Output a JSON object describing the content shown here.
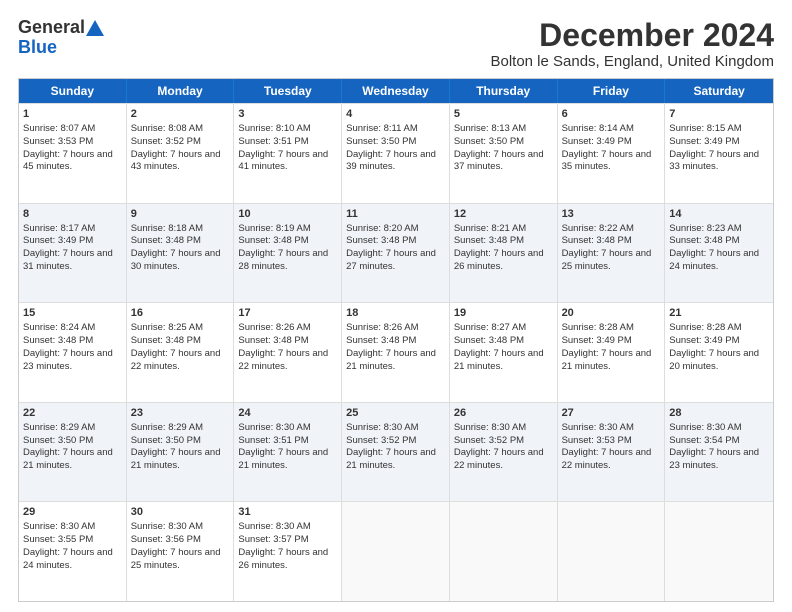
{
  "logo": {
    "line1": "General",
    "line2": "Blue"
  },
  "title": "December 2024",
  "subtitle": "Bolton le Sands, England, United Kingdom",
  "header_days": [
    "Sunday",
    "Monday",
    "Tuesday",
    "Wednesday",
    "Thursday",
    "Friday",
    "Saturday"
  ],
  "weeks": [
    [
      {
        "day": "1",
        "rise": "Sunrise: 8:07 AM",
        "set": "Sunset: 3:53 PM",
        "daylight": "Daylight: 7 hours and 45 minutes."
      },
      {
        "day": "2",
        "rise": "Sunrise: 8:08 AM",
        "set": "Sunset: 3:52 PM",
        "daylight": "Daylight: 7 hours and 43 minutes."
      },
      {
        "day": "3",
        "rise": "Sunrise: 8:10 AM",
        "set": "Sunset: 3:51 PM",
        "daylight": "Daylight: 7 hours and 41 minutes."
      },
      {
        "day": "4",
        "rise": "Sunrise: 8:11 AM",
        "set": "Sunset: 3:50 PM",
        "daylight": "Daylight: 7 hours and 39 minutes."
      },
      {
        "day": "5",
        "rise": "Sunrise: 8:13 AM",
        "set": "Sunset: 3:50 PM",
        "daylight": "Daylight: 7 hours and 37 minutes."
      },
      {
        "day": "6",
        "rise": "Sunrise: 8:14 AM",
        "set": "Sunset: 3:49 PM",
        "daylight": "Daylight: 7 hours and 35 minutes."
      },
      {
        "day": "7",
        "rise": "Sunrise: 8:15 AM",
        "set": "Sunset: 3:49 PM",
        "daylight": "Daylight: 7 hours and 33 minutes."
      }
    ],
    [
      {
        "day": "8",
        "rise": "Sunrise: 8:17 AM",
        "set": "Sunset: 3:49 PM",
        "daylight": "Daylight: 7 hours and 31 minutes."
      },
      {
        "day": "9",
        "rise": "Sunrise: 8:18 AM",
        "set": "Sunset: 3:48 PM",
        "daylight": "Daylight: 7 hours and 30 minutes."
      },
      {
        "day": "10",
        "rise": "Sunrise: 8:19 AM",
        "set": "Sunset: 3:48 PM",
        "daylight": "Daylight: 7 hours and 28 minutes."
      },
      {
        "day": "11",
        "rise": "Sunrise: 8:20 AM",
        "set": "Sunset: 3:48 PM",
        "daylight": "Daylight: 7 hours and 27 minutes."
      },
      {
        "day": "12",
        "rise": "Sunrise: 8:21 AM",
        "set": "Sunset: 3:48 PM",
        "daylight": "Daylight: 7 hours and 26 minutes."
      },
      {
        "day": "13",
        "rise": "Sunrise: 8:22 AM",
        "set": "Sunset: 3:48 PM",
        "daylight": "Daylight: 7 hours and 25 minutes."
      },
      {
        "day": "14",
        "rise": "Sunrise: 8:23 AM",
        "set": "Sunset: 3:48 PM",
        "daylight": "Daylight: 7 hours and 24 minutes."
      }
    ],
    [
      {
        "day": "15",
        "rise": "Sunrise: 8:24 AM",
        "set": "Sunset: 3:48 PM",
        "daylight": "Daylight: 7 hours and 23 minutes."
      },
      {
        "day": "16",
        "rise": "Sunrise: 8:25 AM",
        "set": "Sunset: 3:48 PM",
        "daylight": "Daylight: 7 hours and 22 minutes."
      },
      {
        "day": "17",
        "rise": "Sunrise: 8:26 AM",
        "set": "Sunset: 3:48 PM",
        "daylight": "Daylight: 7 hours and 22 minutes."
      },
      {
        "day": "18",
        "rise": "Sunrise: 8:26 AM",
        "set": "Sunset: 3:48 PM",
        "daylight": "Daylight: 7 hours and 21 minutes."
      },
      {
        "day": "19",
        "rise": "Sunrise: 8:27 AM",
        "set": "Sunset: 3:48 PM",
        "daylight": "Daylight: 7 hours and 21 minutes."
      },
      {
        "day": "20",
        "rise": "Sunrise: 8:28 AM",
        "set": "Sunset: 3:49 PM",
        "daylight": "Daylight: 7 hours and 21 minutes."
      },
      {
        "day": "21",
        "rise": "Sunrise: 8:28 AM",
        "set": "Sunset: 3:49 PM",
        "daylight": "Daylight: 7 hours and 20 minutes."
      }
    ],
    [
      {
        "day": "22",
        "rise": "Sunrise: 8:29 AM",
        "set": "Sunset: 3:50 PM",
        "daylight": "Daylight: 7 hours and 21 minutes."
      },
      {
        "day": "23",
        "rise": "Sunrise: 8:29 AM",
        "set": "Sunset: 3:50 PM",
        "daylight": "Daylight: 7 hours and 21 minutes."
      },
      {
        "day": "24",
        "rise": "Sunrise: 8:30 AM",
        "set": "Sunset: 3:51 PM",
        "daylight": "Daylight: 7 hours and 21 minutes."
      },
      {
        "day": "25",
        "rise": "Sunrise: 8:30 AM",
        "set": "Sunset: 3:52 PM",
        "daylight": "Daylight: 7 hours and 21 minutes."
      },
      {
        "day": "26",
        "rise": "Sunrise: 8:30 AM",
        "set": "Sunset: 3:52 PM",
        "daylight": "Daylight: 7 hours and 22 minutes."
      },
      {
        "day": "27",
        "rise": "Sunrise: 8:30 AM",
        "set": "Sunset: 3:53 PM",
        "daylight": "Daylight: 7 hours and 22 minutes."
      },
      {
        "day": "28",
        "rise": "Sunrise: 8:30 AM",
        "set": "Sunset: 3:54 PM",
        "daylight": "Daylight: 7 hours and 23 minutes."
      }
    ],
    [
      {
        "day": "29",
        "rise": "Sunrise: 8:30 AM",
        "set": "Sunset: 3:55 PM",
        "daylight": "Daylight: 7 hours and 24 minutes."
      },
      {
        "day": "30",
        "rise": "Sunrise: 8:30 AM",
        "set": "Sunset: 3:56 PM",
        "daylight": "Daylight: 7 hours and 25 minutes."
      },
      {
        "day": "31",
        "rise": "Sunrise: 8:30 AM",
        "set": "Sunset: 3:57 PM",
        "daylight": "Daylight: 7 hours and 26 minutes."
      },
      null,
      null,
      null,
      null
    ]
  ]
}
